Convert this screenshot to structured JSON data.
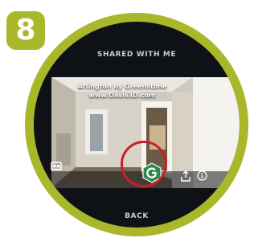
{
  "step_number": "8",
  "header": {
    "title": "SHARED WITH ME"
  },
  "card": {
    "caption_line1": "Arlington by Greenstone",
    "caption_line2": "www.Oasis3D.com"
  },
  "footer": {
    "back_label": "BACK"
  },
  "colors": {
    "accent": "#a8b82a",
    "highlight_ring": "#cc1f27",
    "logo_green": "#2f8a4a"
  },
  "icons": [
    "vr-headset-icon",
    "greenstone-logo-icon",
    "share-icon",
    "info-icon"
  ]
}
